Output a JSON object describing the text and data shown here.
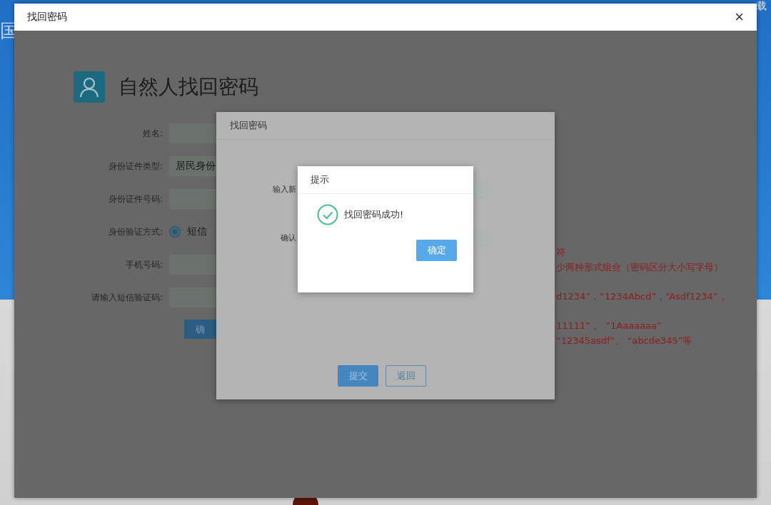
{
  "backdrop": {
    "left_glyph": "国",
    "right_glyph": "载"
  },
  "window": {
    "title": "找回密码",
    "close": "×"
  },
  "page": {
    "heading": "自然人找回密码",
    "fields": [
      {
        "label": "姓名:",
        "kind": "input"
      },
      {
        "label": "身份证件类型:",
        "kind": "select",
        "value": "居民身份"
      },
      {
        "label": "身份证件号码:",
        "kind": "input"
      },
      {
        "label": "身份验证方式:",
        "kind": "radio",
        "options": [
          {
            "label": "短信",
            "selected": true
          }
        ]
      },
      {
        "label": "手机号码:",
        "kind": "input"
      },
      {
        "label": "请输入短信验证码:",
        "kind": "input"
      }
    ],
    "button": "确",
    "notes": [
      "符",
      "少两种形式组合（密码区分大小写字母）",
      "d1234”，“1234Abcd”，“Asdf1234”，",
      "11111”，  “1Aaaaaaa”",
      "“12345asdf”、 “abcde345”等"
    ]
  },
  "reset_dialog": {
    "title": "找回密码",
    "fields": [
      {
        "label": "输入新"
      },
      {
        "label": "确认"
      }
    ],
    "buttons": [
      {
        "label": "提交",
        "kind": "primary"
      },
      {
        "label": "返回",
        "kind": "secondary"
      }
    ]
  },
  "alert": {
    "title": "提示",
    "kind": "success",
    "message": "找回密码成功!",
    "button": "确定"
  }
}
